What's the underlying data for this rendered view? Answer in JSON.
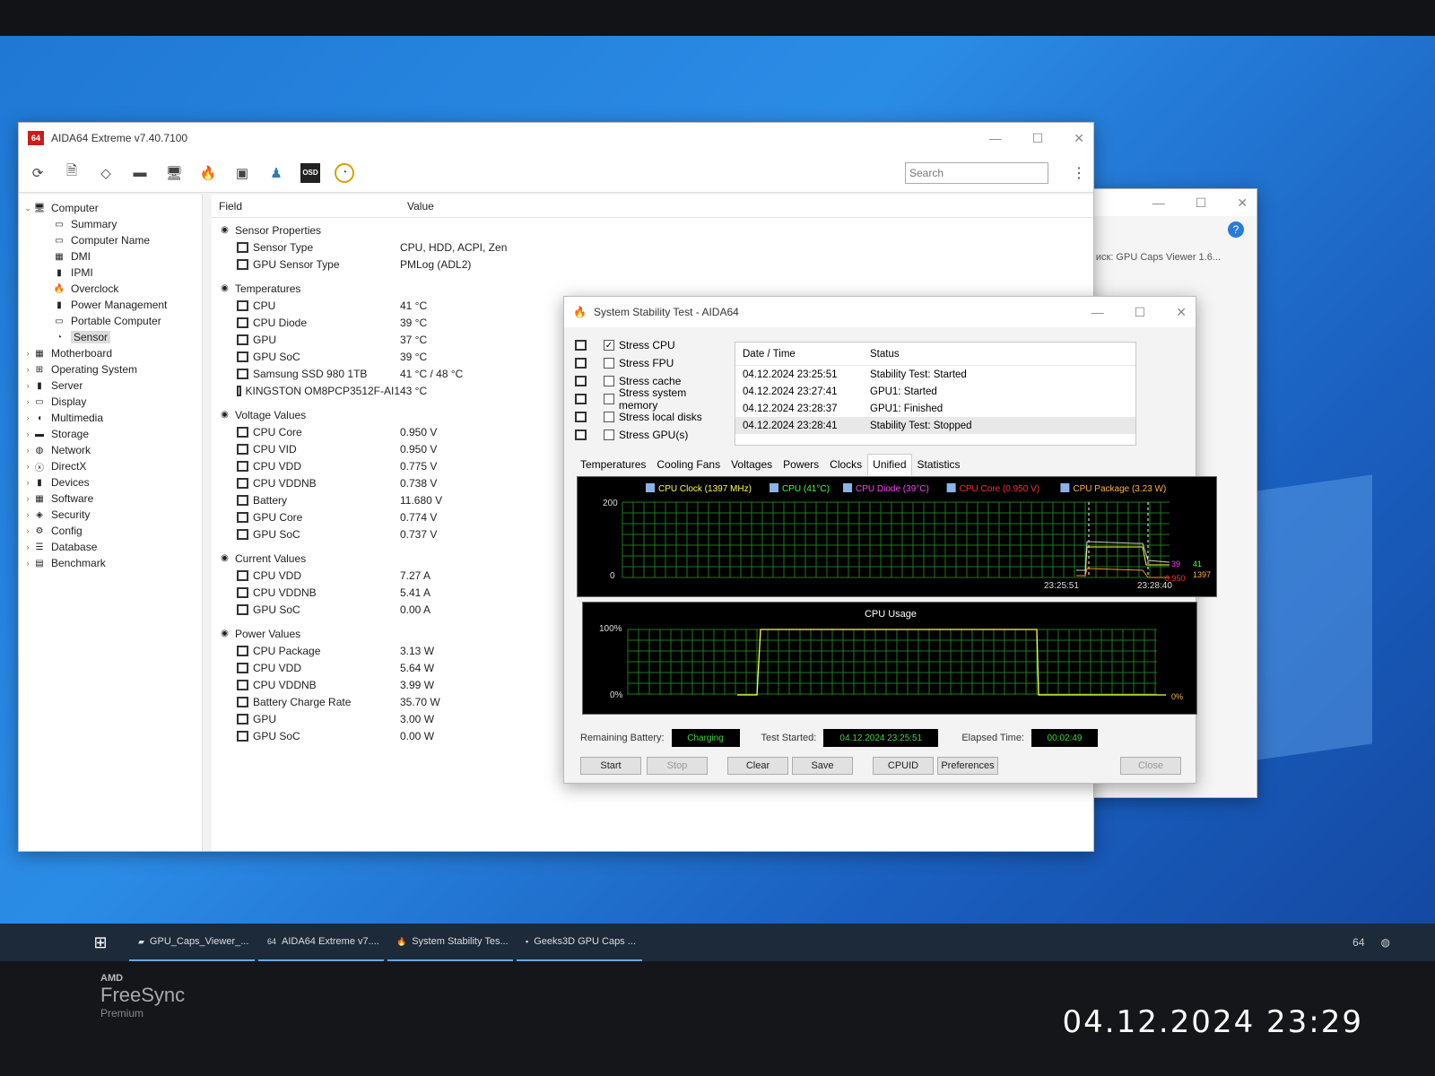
{
  "main_window": {
    "title": "AIDA64 Extreme v7.40.7100",
    "search_placeholder": "Search",
    "tree": [
      {
        "label": "Computer",
        "icon": "computer-icon",
        "level": 0,
        "expanded": true
      },
      {
        "label": "Summary",
        "icon": "summary-icon",
        "level": 1
      },
      {
        "label": "Computer Name",
        "icon": "computer-name-icon",
        "level": 1
      },
      {
        "label": "DMI",
        "icon": "dmi-icon",
        "level": 1
      },
      {
        "label": "IPMI",
        "icon": "ipmi-icon",
        "level": 1
      },
      {
        "label": "Overclock",
        "icon": "flame-icon",
        "level": 1
      },
      {
        "label": "Power Management",
        "icon": "battery-icon",
        "level": 1
      },
      {
        "label": "Portable Computer",
        "icon": "laptop-icon",
        "level": 1
      },
      {
        "label": "Sensor",
        "icon": "gauge-icon",
        "level": 1,
        "selected": true
      },
      {
        "label": "Motherboard",
        "icon": "motherboard-icon",
        "level": 0
      },
      {
        "label": "Operating System",
        "icon": "windows-icon",
        "level": 0
      },
      {
        "label": "Server",
        "icon": "server-icon",
        "level": 0
      },
      {
        "label": "Display",
        "icon": "display-icon",
        "level": 0
      },
      {
        "label": "Multimedia",
        "icon": "speaker-icon",
        "level": 0
      },
      {
        "label": "Storage",
        "icon": "disk-icon",
        "level": 0
      },
      {
        "label": "Network",
        "icon": "network-icon",
        "level": 0
      },
      {
        "label": "DirectX",
        "icon": "directx-icon",
        "level": 0
      },
      {
        "label": "Devices",
        "icon": "devices-icon",
        "level": 0
      },
      {
        "label": "Software",
        "icon": "software-icon",
        "level": 0
      },
      {
        "label": "Security",
        "icon": "shield-icon",
        "level": 0
      },
      {
        "label": "Config",
        "icon": "config-icon",
        "level": 0
      },
      {
        "label": "Database",
        "icon": "database-icon",
        "level": 0
      },
      {
        "label": "Benchmark",
        "icon": "benchmark-icon",
        "level": 0
      }
    ],
    "columns": {
      "field": "Field",
      "value": "Value"
    },
    "groups": [
      {
        "label": "Sensor Properties",
        "rows": [
          {
            "field": "Sensor Type",
            "value": "CPU, HDD, ACPI, Zen"
          },
          {
            "field": "GPU Sensor Type",
            "value": "PMLog  (ADL2)"
          }
        ]
      },
      {
        "label": "Temperatures",
        "rows": [
          {
            "field": "CPU",
            "value": "41 °C"
          },
          {
            "field": "CPU Diode",
            "value": "39 °C"
          },
          {
            "field": "GPU",
            "value": "37 °C"
          },
          {
            "field": "GPU SoC",
            "value": "39 °C"
          },
          {
            "field": "Samsung SSD 980 1TB",
            "value": "41 °C / 48 °C"
          },
          {
            "field": "KINGSTON OM8PCP3512F-AI1",
            "value": "43 °C"
          }
        ]
      },
      {
        "label": "Voltage Values",
        "rows": [
          {
            "field": "CPU Core",
            "value": "0.950 V"
          },
          {
            "field": "CPU VID",
            "value": "0.950 V"
          },
          {
            "field": "CPU VDD",
            "value": "0.775 V"
          },
          {
            "field": "CPU VDDNB",
            "value": "0.738 V"
          },
          {
            "field": "Battery",
            "value": "11.680 V"
          },
          {
            "field": "GPU Core",
            "value": "0.774 V"
          },
          {
            "field": "GPU SoC",
            "value": "0.737 V"
          }
        ]
      },
      {
        "label": "Current Values",
        "rows": [
          {
            "field": "CPU VDD",
            "value": "7.27 A"
          },
          {
            "field": "CPU VDDNB",
            "value": "5.41 A"
          },
          {
            "field": "GPU SoC",
            "value": "0.00 A"
          }
        ]
      },
      {
        "label": "Power Values",
        "rows": [
          {
            "field": "CPU Package",
            "value": "3.13 W"
          },
          {
            "field": "CPU VDD",
            "value": "5.64 W"
          },
          {
            "field": "CPU VDDNB",
            "value": "3.99 W"
          },
          {
            "field": "Battery Charge Rate",
            "value": "35.70 W"
          },
          {
            "field": "GPU",
            "value": "3.00 W"
          },
          {
            "field": "GPU SoC",
            "value": "0.00 W"
          }
        ]
      }
    ]
  },
  "back_window": {
    "search_text": "иск: GPU Caps Viewer 1.6..."
  },
  "stability": {
    "title": "System Stability Test - AIDA64",
    "stress": [
      {
        "label": "Stress CPU",
        "checked": true
      },
      {
        "label": "Stress FPU",
        "checked": false
      },
      {
        "label": "Stress cache",
        "checked": false
      },
      {
        "label": "Stress system memory",
        "checked": false
      },
      {
        "label": "Stress local disks",
        "checked": false
      },
      {
        "label": "Stress GPU(s)",
        "checked": false
      }
    ],
    "log_headers": {
      "date": "Date / Time",
      "status": "Status"
    },
    "log": [
      {
        "date": "04.12.2024 23:25:51",
        "status": "Stability Test: Started"
      },
      {
        "date": "04.12.2024 23:27:41",
        "status": "GPU1: Started"
      },
      {
        "date": "04.12.2024 23:28:37",
        "status": "GPU1: Finished"
      },
      {
        "date": "04.12.2024 23:28:41",
        "status": "Stability Test: Stopped"
      }
    ],
    "tabs": [
      "Temperatures",
      "Cooling Fans",
      "Voltages",
      "Powers",
      "Clocks",
      "Unified",
      "Statistics"
    ],
    "active_tab": "Unified",
    "legend": [
      {
        "label": "CPU Clock (1397 MHz)",
        "color": "#ffff40"
      },
      {
        "label": "CPU (41°C)",
        "color": "#40ff40"
      },
      {
        "label": "CPU Diode (39°C)",
        "color": "#ff40ff"
      },
      {
        "label": "CPU Core (0.950 V)",
        "color": "#ff3030"
      },
      {
        "label": "CPU Package (3.23 W)",
        "color": "#ffb040"
      }
    ],
    "graph1": {
      "ymax": "200",
      "ymin": "0",
      "t1": "23:25:51",
      "t2": "23:28:40",
      "r1": "39",
      "r2": "41",
      "r3": "0.950",
      "r4": "1397"
    },
    "graph2": {
      "title": "CPU Usage",
      "ymax": "100%",
      "ymin": "0%",
      "right": "0%"
    },
    "remaining_battery_label": "Remaining Battery:",
    "remaining_battery": "Charging",
    "test_started_label": "Test Started:",
    "test_started": "04.12.2024 23:25:51",
    "elapsed_label": "Elapsed Time:",
    "elapsed": "00:02:49",
    "buttons": {
      "start": "Start",
      "stop": "Stop",
      "clear": "Clear",
      "save": "Save",
      "cpuid": "CPUID",
      "preferences": "Preferences",
      "close": "Close"
    }
  },
  "taskbar": [
    {
      "label": "GPU_Caps_Viewer_...",
      "icon": "folder-icon"
    },
    {
      "label": "AIDA64 Extreme v7....",
      "icon": "aida-icon"
    },
    {
      "label": "System Stability Tes...",
      "icon": "flame-icon"
    },
    {
      "label": "Geeks3D GPU Caps ...",
      "icon": "app-icon"
    }
  ],
  "bezel": {
    "brand_top": "AMD",
    "brand": "FreeSync",
    "brand_sub": "Premium"
  },
  "photo_timestamp": "04.12.2024 23:29"
}
